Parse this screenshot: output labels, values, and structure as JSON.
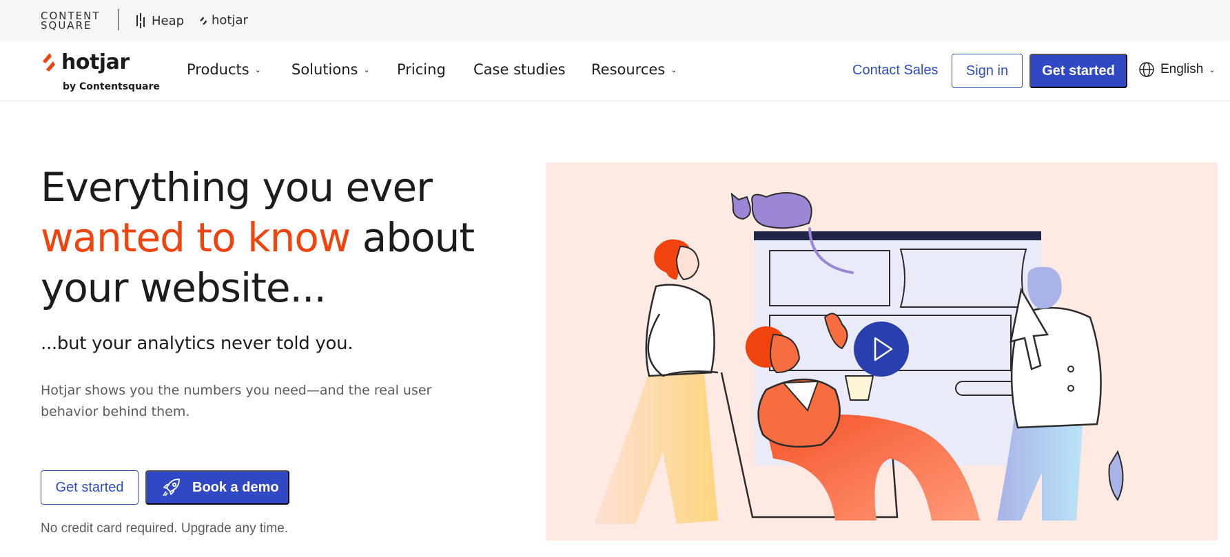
{
  "brand_bar": {
    "contentsquare_line1": "CONTENT",
    "contentsquare_line2": "SQUARE",
    "heap_label": "Heap",
    "hotjar_label": "hotjar"
  },
  "logo": {
    "wordmark": "hotjar",
    "byline": "by Contentsquare"
  },
  "nav": {
    "items": [
      {
        "label": "Products",
        "has_dropdown": true
      },
      {
        "label": "Solutions",
        "has_dropdown": true
      },
      {
        "label": "Pricing",
        "has_dropdown": false
      },
      {
        "label": "Case studies",
        "has_dropdown": false
      },
      {
        "label": "Resources",
        "has_dropdown": true
      }
    ],
    "contact_sales": "Contact Sales",
    "sign_in": "Sign in",
    "get_started": "Get started",
    "language": "English"
  },
  "hero": {
    "title_part1": "Everything you ever",
    "title_accent": "wanted to know",
    "title_part2": "about",
    "title_part3": "your website...",
    "subtitle": "...but your analytics never told you.",
    "description": "Hotjar shows you the numbers you need—and the real user behavior behind them.",
    "get_started": "Get started",
    "book_demo": "Book a demo",
    "fineprint": "No credit card required. Upgrade any time."
  },
  "colors": {
    "accent_orange": "#f0430e",
    "brand_blue": "#3048c4",
    "illustration_bg": "#fee9e3"
  },
  "icons": {
    "play": "play-icon",
    "globe": "globe-icon",
    "rocket": "rocket-icon"
  }
}
